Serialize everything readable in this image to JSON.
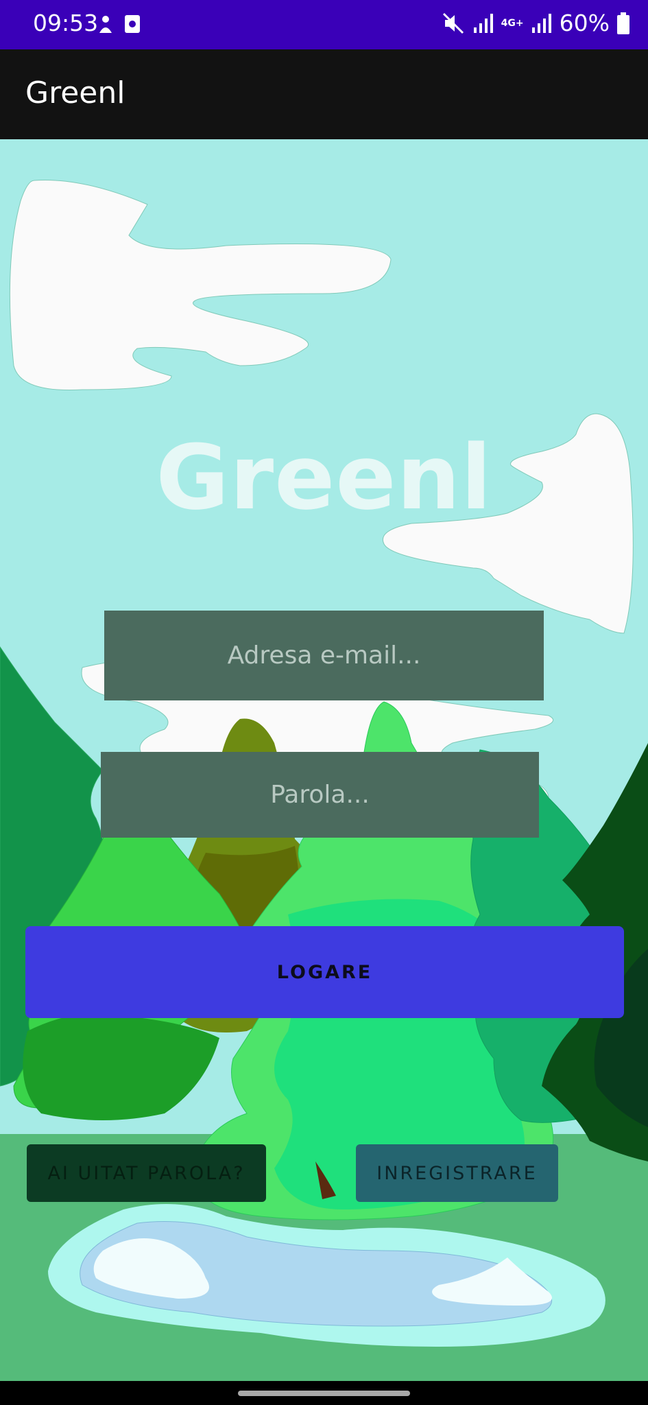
{
  "status_bar": {
    "time": "09:53",
    "battery": "60%",
    "network": "4G+",
    "colors": {
      "background": "#3a00b8"
    }
  },
  "app_bar": {
    "title": "Greenl"
  },
  "hero": {
    "title": "Greenl"
  },
  "login_form": {
    "email_placeholder": "Adresa e-mail...",
    "password_placeholder": "Parola...",
    "login_label": "LOGARE",
    "forgot_label": "AI UITAT PAROLA?",
    "register_label": "INREGISTRARE"
  },
  "icons": [
    "mute-icon",
    "signal-icon",
    "battery-icon",
    "notification-icon",
    "screenshot-icon"
  ],
  "colors": {
    "sky": "#a6ebe6",
    "grass": "#55bb7a",
    "login_button": "#3e3be0",
    "field": "#4b6b5e"
  }
}
